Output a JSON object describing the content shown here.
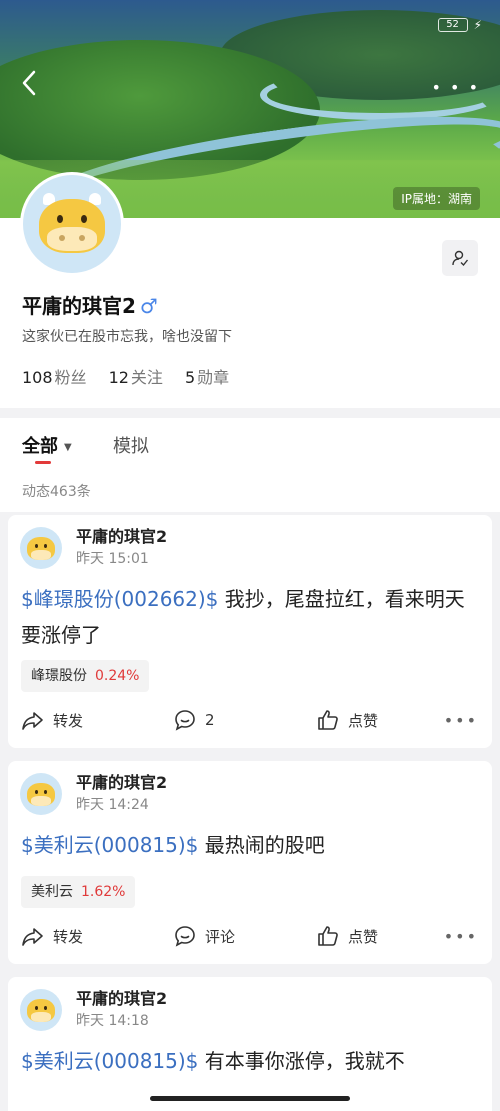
{
  "status_bar": {
    "battery": "52"
  },
  "banner": {
    "ip_location": "IP属地：湖南"
  },
  "profile": {
    "name": "平庸的琪官2",
    "gender_symbol": "♂",
    "bio": "这家伙已在股市忘我，啥也没留下",
    "stats": [
      {
        "value": "108",
        "label": "粉丝"
      },
      {
        "value": "12",
        "label": "关注"
      },
      {
        "value": "5",
        "label": "勋章"
      }
    ]
  },
  "tabs": {
    "all": "全部",
    "simulated": "模拟"
  },
  "feed_count": "动态463条",
  "posts": [
    {
      "author": "平庸的琪官2",
      "time": "昨天 15:01",
      "stock_link": "$峰璟股份(002662)$",
      "text": " 我抄，尾盘拉红，看来明天要涨停了",
      "stock_name": "峰璟股份",
      "stock_change": "0.24%",
      "repost_label": "转发",
      "comment_label": "2",
      "like_label": "点赞"
    },
    {
      "author": "平庸的琪官2",
      "time": "昨天 14:24",
      "stock_link": "$美利云(000815)$",
      "text": " 最热闹的股吧",
      "stock_name": "美利云",
      "stock_change": "1.62%",
      "repost_label": "转发",
      "comment_label": "评论",
      "like_label": "点赞"
    },
    {
      "author": "平庸的琪官2",
      "time": "昨天 14:18",
      "stock_link": "$美利云(000815)$",
      "text": " 有本事你涨停，我就不"
    }
  ],
  "colors": {
    "accent_red": "#e23a3a",
    "link_blue": "#3b6fc0",
    "gender_blue": "#4a86e8"
  }
}
